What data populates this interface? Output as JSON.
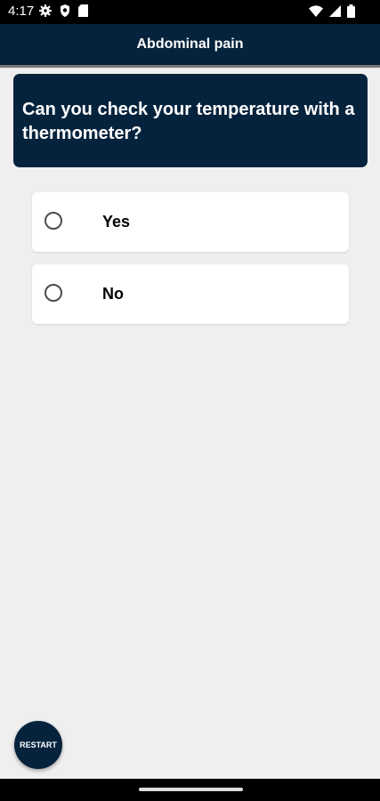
{
  "status_bar": {
    "time": "4:17"
  },
  "app_bar": {
    "title": "Abdominal pain"
  },
  "question": {
    "text": "Can you check your temperature with a thermometer?"
  },
  "options": [
    {
      "label": "Yes",
      "selected": false
    },
    {
      "label": "No",
      "selected": false
    }
  ],
  "restart_button": {
    "label": "RESTART"
  },
  "colors": {
    "primary": "#06233d",
    "background": "#efefef",
    "card": "#ffffff"
  },
  "icons": [
    "settings-icon",
    "shield-icon",
    "sd-card-icon",
    "wifi-icon",
    "signal-icon",
    "battery-icon"
  ]
}
